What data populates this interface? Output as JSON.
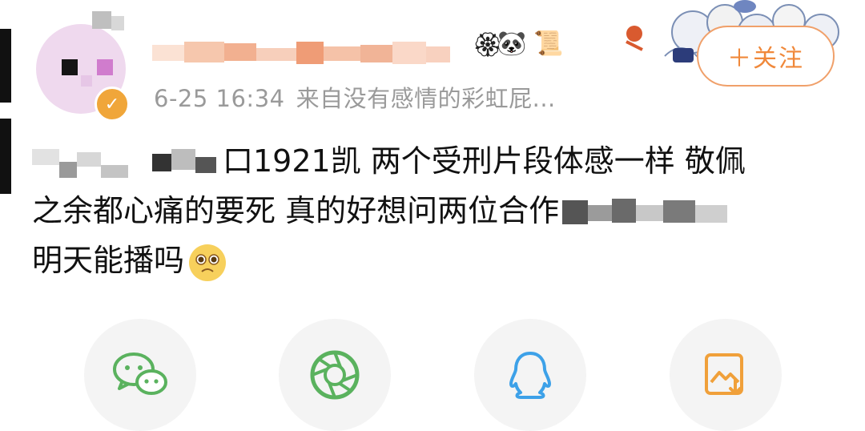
{
  "header": {
    "time": "6-25 16:34",
    "source": "来自没有感情的彩虹屁...",
    "follow_label": "＋关注",
    "verified_icon": "verified-badge-icon",
    "emojis": [
      "panda-emoji-icon",
      "diploma-emoji-icon"
    ]
  },
  "post": {
    "line1_text": "口1921凯 两个受刑片段体感一样 敬佩",
    "line2_text": "之余都心痛的要死 真的好想问两位合作",
    "line3_text": "明天能播吗",
    "end_emoji": "pleading-face-emoji"
  },
  "share": [
    {
      "icon": "wechat-icon",
      "color": "#5ab25e"
    },
    {
      "icon": "moments-icon",
      "color": "#5ab25e"
    },
    {
      "icon": "qq-icon",
      "color": "#3da1e8"
    },
    {
      "icon": "save-image-icon",
      "color": "#f0a03a"
    }
  ],
  "colors": {
    "accent": "#f0883a",
    "meta": "#9a9a9a"
  }
}
